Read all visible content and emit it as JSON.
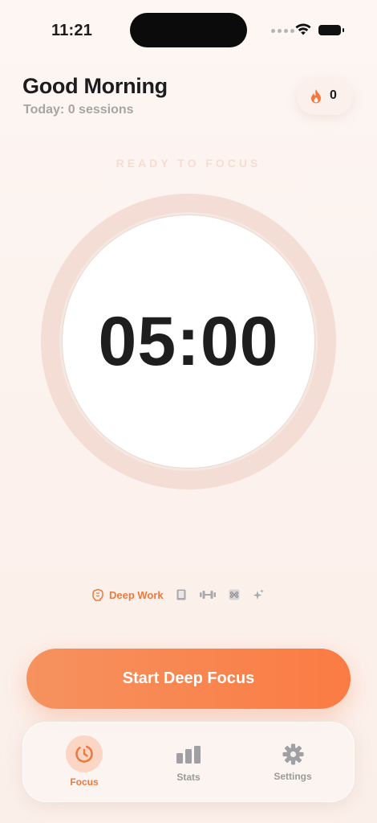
{
  "status": {
    "time": "11:21"
  },
  "header": {
    "greeting": "Good Morning",
    "sessions": "Today: 0 sessions",
    "streak": "0"
  },
  "focus": {
    "state_label": "READY TO FOCUS",
    "timer": "05:00"
  },
  "modes": {
    "active_label": "Deep Work",
    "items": [
      "brain-icon",
      "book-icon",
      "dumbbell-icon",
      "command-icon",
      "sparkles-icon"
    ]
  },
  "cta": {
    "label": "Start Deep Focus"
  },
  "tabbar": {
    "tabs": [
      {
        "label": "Focus",
        "icon": "timer-icon",
        "active": true
      },
      {
        "label": "Stats",
        "icon": "bar-chart-icon",
        "active": false
      },
      {
        "label": "Settings",
        "icon": "gear-icon",
        "active": false
      }
    ]
  },
  "colors": {
    "accent": "#f6925f",
    "accent_text": "#ec7a3e",
    "ring": "#f3ddd4",
    "muted": "#9a9a9a"
  }
}
